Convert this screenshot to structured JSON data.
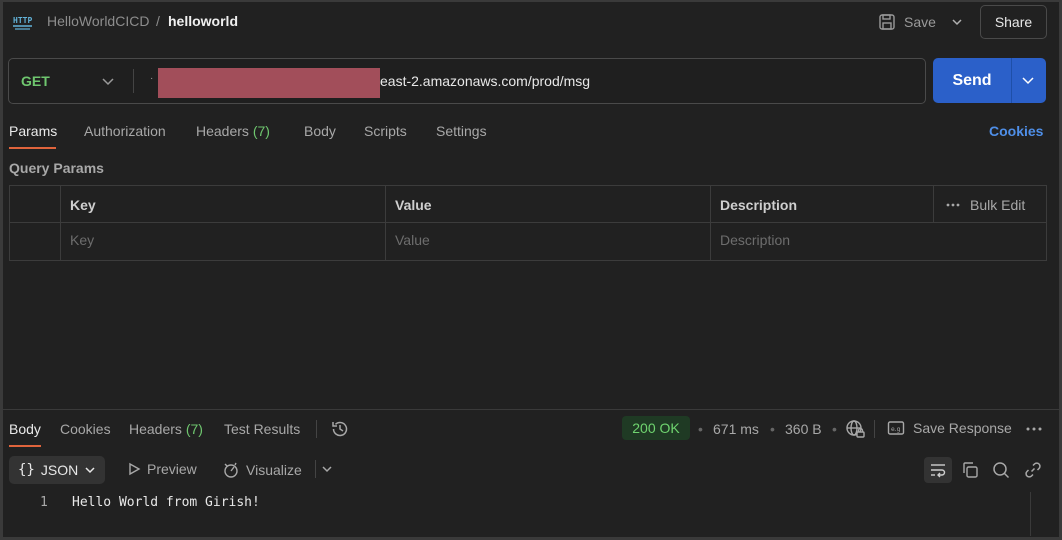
{
  "breadcrumb": {
    "collection": "HelloWorldCICD",
    "separator": "/",
    "request": "helloworld"
  },
  "toolbar": {
    "save_label": "Save",
    "share_label": "Share"
  },
  "request": {
    "method": "GET",
    "url_visible": "east-2.amazonaws.com/prod/msg",
    "send_label": "Send"
  },
  "request_tabs": {
    "params": "Params",
    "authorization": "Authorization",
    "headers": "Headers",
    "headers_count": "(7)",
    "body": "Body",
    "scripts": "Scripts",
    "settings": "Settings",
    "cookies": "Cookies"
  },
  "query_params": {
    "title": "Query Params",
    "columns": {
      "key": "Key",
      "value": "Value",
      "description": "Description"
    },
    "bulk_edit": "Bulk Edit",
    "placeholders": {
      "key": "Key",
      "value": "Value",
      "description": "Description"
    }
  },
  "response": {
    "tabs": {
      "body": "Body",
      "cookies": "Cookies",
      "headers": "Headers",
      "headers_count": "(7)",
      "test_results": "Test Results"
    },
    "status": "200 OK",
    "time": "671 ms",
    "size": "360 B",
    "save_response": "Save Response",
    "format": "JSON",
    "preview": "Preview",
    "visualize": "Visualize",
    "lines": [
      {
        "number": "1",
        "text": "Hello World from Girish!"
      }
    ]
  },
  "colors": {
    "accent_orange": "#e0643c",
    "send_blue": "#2b60c9",
    "method_green": "#6fc76f",
    "link_blue": "#4f8fe8",
    "redaction": "#a24e5a"
  },
  "icons": [
    "http-icon",
    "save-icon",
    "chevron-down-icon",
    "history-icon",
    "globe-lock-icon",
    "save-response-icon",
    "more-icon",
    "play-icon",
    "visualize-icon",
    "wrap-icon",
    "copy-icon",
    "search-icon",
    "link-icon"
  ]
}
